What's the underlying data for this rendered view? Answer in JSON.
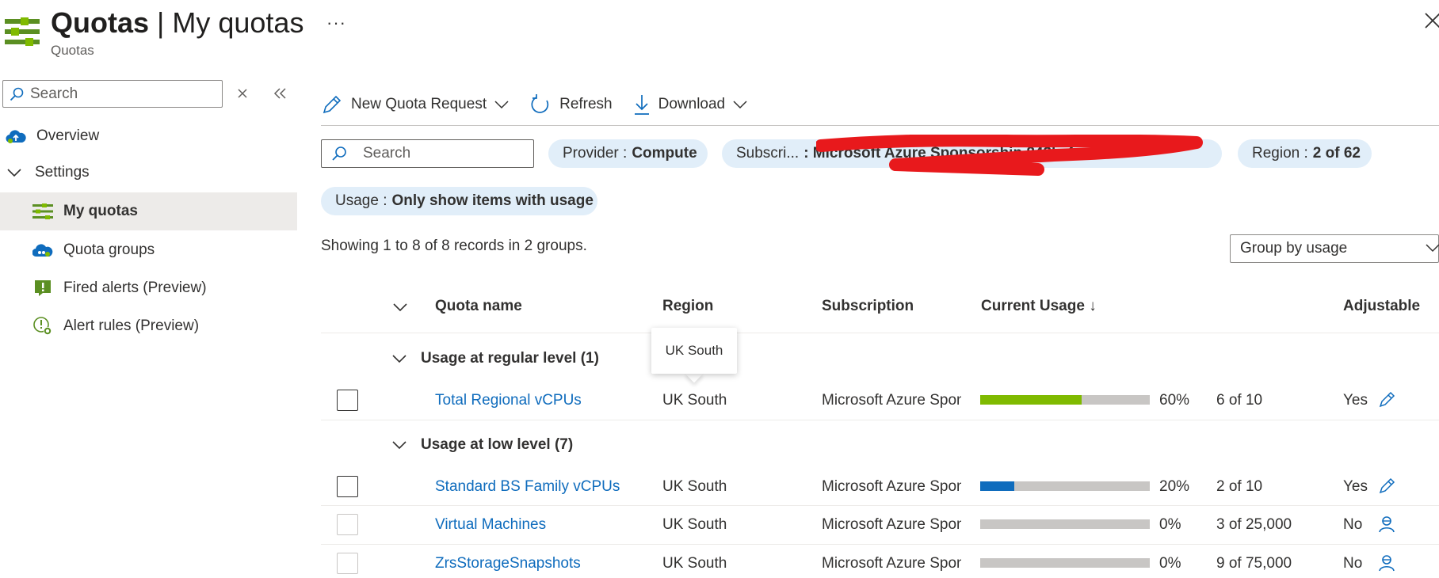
{
  "header": {
    "title_main": "Quotas",
    "title_sep": " | ",
    "title_page": "My quotas",
    "subtitle": "Quotas",
    "more": "···"
  },
  "sidebar": {
    "search_placeholder": "Search",
    "items": [
      {
        "label": "Overview",
        "icon": "cloud-upload-icon"
      },
      {
        "label": "Settings",
        "icon": "chevron-down-icon"
      },
      {
        "label": "My quotas",
        "icon": "quota-list-icon",
        "active": true
      },
      {
        "label": "Quota groups",
        "icon": "cloud-group-icon"
      },
      {
        "label": "Fired alerts (Preview)",
        "icon": "alert-icon"
      },
      {
        "label": "Alert rules (Preview)",
        "icon": "alert-rules-icon"
      }
    ]
  },
  "toolbar": {
    "new_quota": "New Quota Request",
    "refresh": "Refresh",
    "download": "Download"
  },
  "filters": {
    "search_placeholder": "Search",
    "provider_key": "Provider :",
    "provider_val": "Compute",
    "subscription_key": "Subscri...",
    "subscription_val": ": Microsoft Azure Sponsorship 843b-4c... …",
    "region_key": "Region :",
    "region_val": "2 of 62",
    "usage_key": "Usage :",
    "usage_val": "Only show items with usage"
  },
  "records_text": "Showing 1 to 8 of 8 records in 2 groups.",
  "group_by": "Group by usage",
  "table": {
    "headers": {
      "quota_name": "Quota name",
      "region": "Region",
      "subscription": "Subscription",
      "current_usage": "Current Usage ↓",
      "adjustable": "Adjustable"
    },
    "tooltip": "UK South",
    "groups": [
      {
        "title": "Usage at regular level (1)",
        "rows": [
          {
            "name": "Total Regional vCPUs",
            "region": "UK South",
            "subscription": "Microsoft Azure Sponsorship",
            "percent": "60%",
            "pct": 60,
            "count": "6 of 10",
            "adjustable": "Yes",
            "color": "#7fba00"
          }
        ]
      },
      {
        "title": "Usage at low level (7)",
        "rows": [
          {
            "name": "Standard BS Family vCPUs",
            "region": "UK South",
            "subscription": "Microsoft Azure Sponsorship",
            "percent": "20%",
            "pct": 20,
            "count": "2 of 10",
            "adjustable": "Yes",
            "color": "#0f6cbd"
          },
          {
            "name": "Virtual Machines",
            "region": "UK South",
            "subscription": "Microsoft Azure Sponsorship",
            "percent": "0%",
            "pct": 0,
            "count": "3 of 25,000",
            "adjustable": "No",
            "color": "#0f6cbd"
          },
          {
            "name": "ZrsStorageSnapshots",
            "region": "UK South",
            "subscription": "Microsoft Azure Sponsorship",
            "percent": "0%",
            "pct": 0,
            "count": "9 of 75,000",
            "adjustable": "No",
            "color": "#0f6cbd"
          }
        ]
      }
    ]
  },
  "colors": {
    "accent": "#0f6cbd",
    "green": "#7fba00",
    "pill_bg": "#e1eef9",
    "redaction": "#e8191c"
  }
}
